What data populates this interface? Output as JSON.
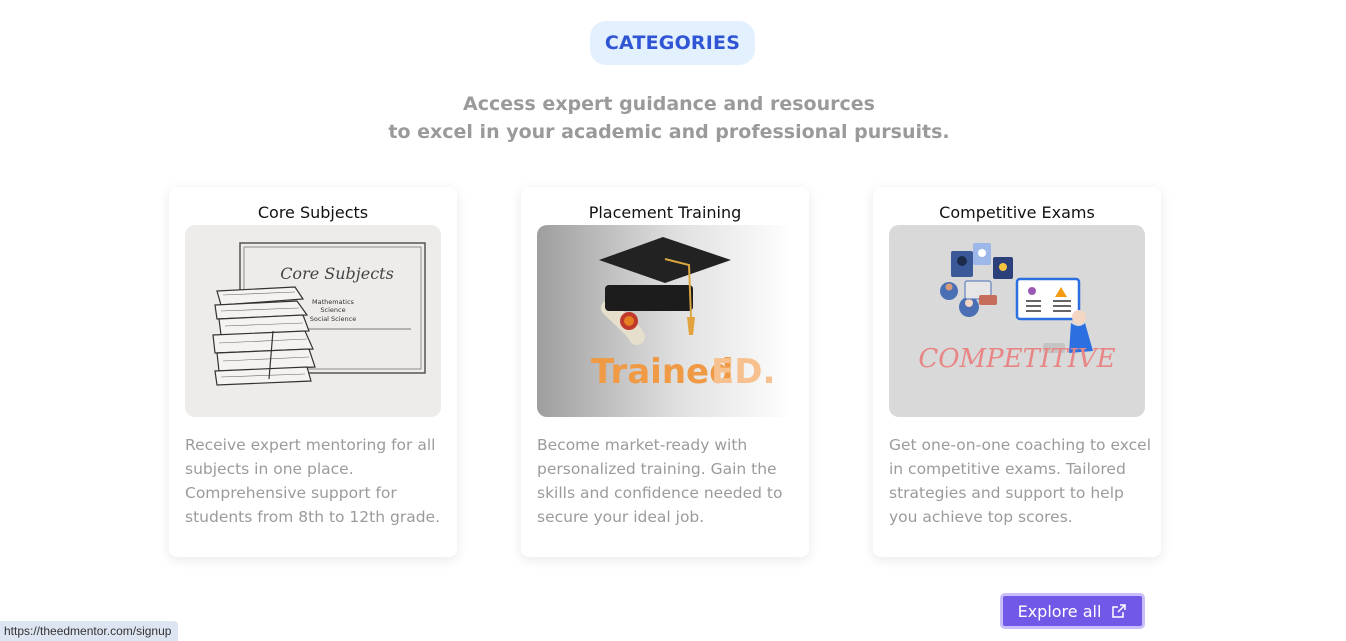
{
  "badge": {
    "label": "CATEGORIES"
  },
  "subtitle": {
    "line1": "Access expert guidance and resources",
    "line2": "to excel in your academic and professional pursuits."
  },
  "cards": [
    {
      "title": "Core Subjects",
      "image": {
        "heading": "Core Subjects",
        "items": [
          "Mathematics",
          "Science",
          "Social Science"
        ]
      },
      "description": "Receive expert mentoring for all subjects in one place. Comprehensive support for students from 8th to 12th grade."
    },
    {
      "title": "Placement Training",
      "image": {
        "logo_part1": "Trained",
        "logo_part2": "ED."
      },
      "description": "Become market-ready with personalized training. Gain the skills and confidence needed to secure your ideal job."
    },
    {
      "title": "Competitive Exams",
      "image": {
        "caption": "COMPETITIVE"
      },
      "description": "Get one-on-one coaching to excel in competitive exams. Tailored strategies and support to help you achieve top scores."
    }
  ],
  "explore": {
    "label": "Explore all",
    "icon": "external-link-icon"
  },
  "status_url": "https://theedmentor.com/signup",
  "colors": {
    "accent": "#2f55d4",
    "button": "#7258e6",
    "badge_bg": "#e3f0fd"
  }
}
